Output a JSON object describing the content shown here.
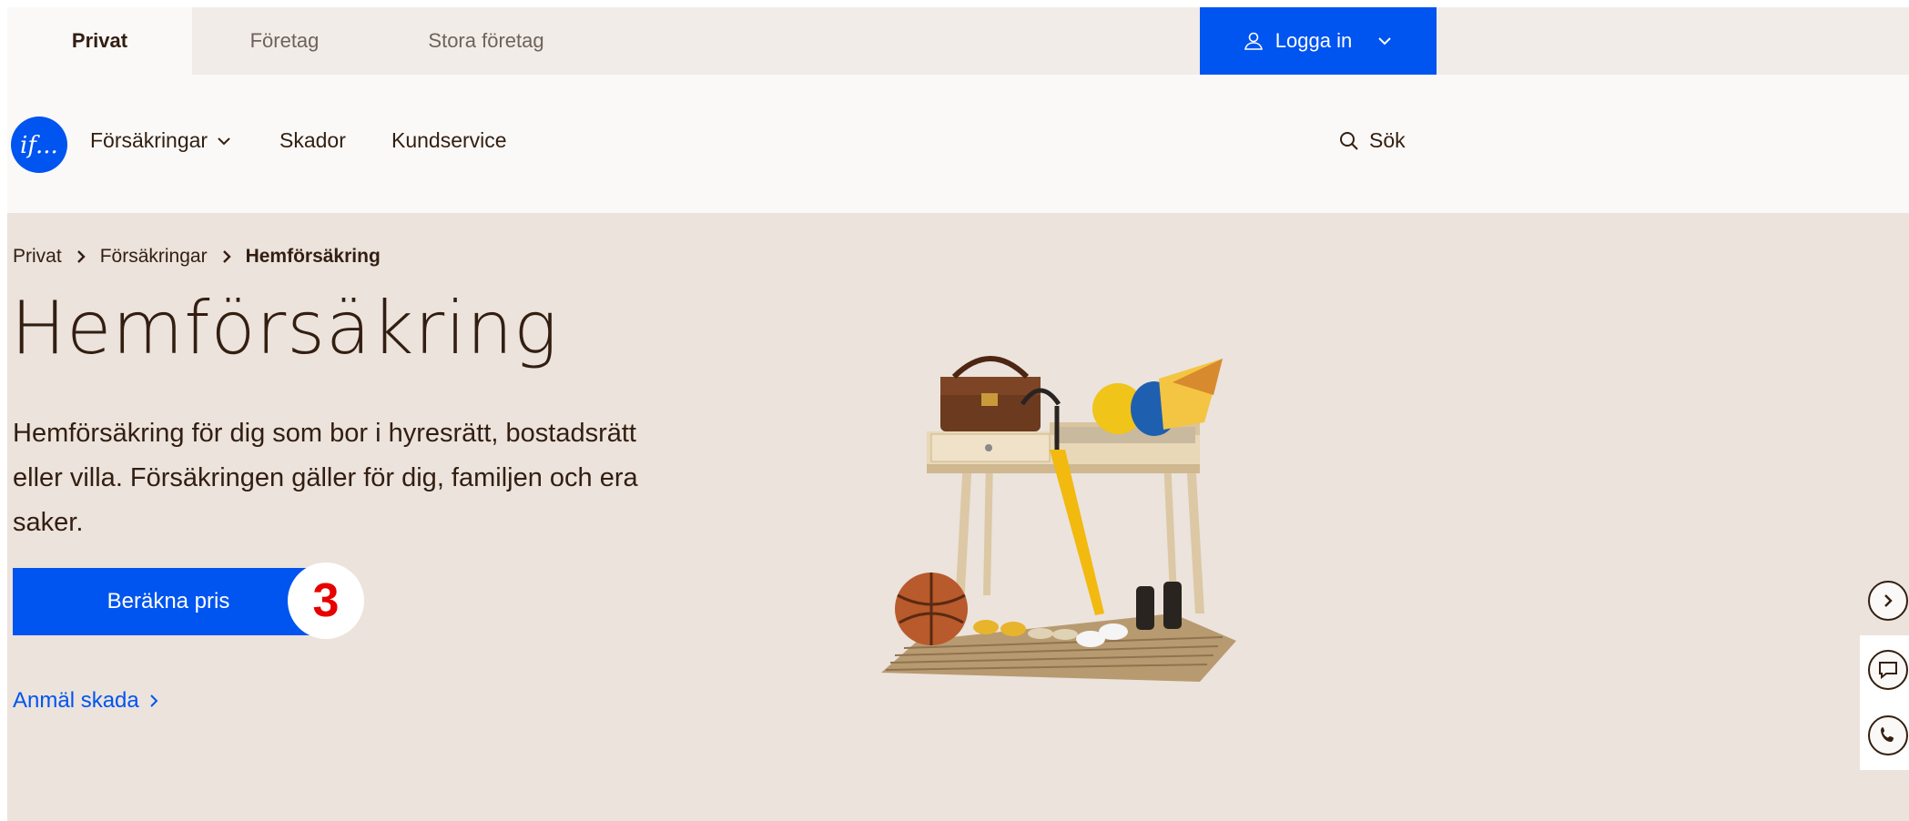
{
  "topbar": {
    "tabs": [
      {
        "label": "Privat",
        "active": true
      },
      {
        "label": "Företag",
        "active": false
      },
      {
        "label": "Stora företag",
        "active": false
      }
    ],
    "login_label": "Logga in"
  },
  "mainnav": {
    "logo_text": "if...",
    "items": [
      "Försäkringar",
      "Skador",
      "Kundservice"
    ],
    "search_label": "Sök"
  },
  "breadcrumb": {
    "items": [
      "Privat",
      "Försäkringar",
      "Hemförsäkring"
    ]
  },
  "hero": {
    "title": "Hemförsäkring",
    "lead": "Hemförsäkring för dig som bor i hyresrätt, bostadsrätt eller villa. Försäkringen gäller för dig, familjen och era saker.",
    "cta_label": "Beräkna pris",
    "marker_number": "3",
    "report_link": "Anmäl skada"
  },
  "icons": {
    "user": "user-icon",
    "chevron": "chevron-down-icon",
    "search": "search-icon",
    "side": [
      "chevron-right-icon",
      "chat-icon",
      "phone-icon"
    ]
  },
  "colors": {
    "brand_blue": "#0054f0",
    "hero_bg": "#ebe3dc",
    "text": "#331e11",
    "marker_red": "#e60000"
  }
}
